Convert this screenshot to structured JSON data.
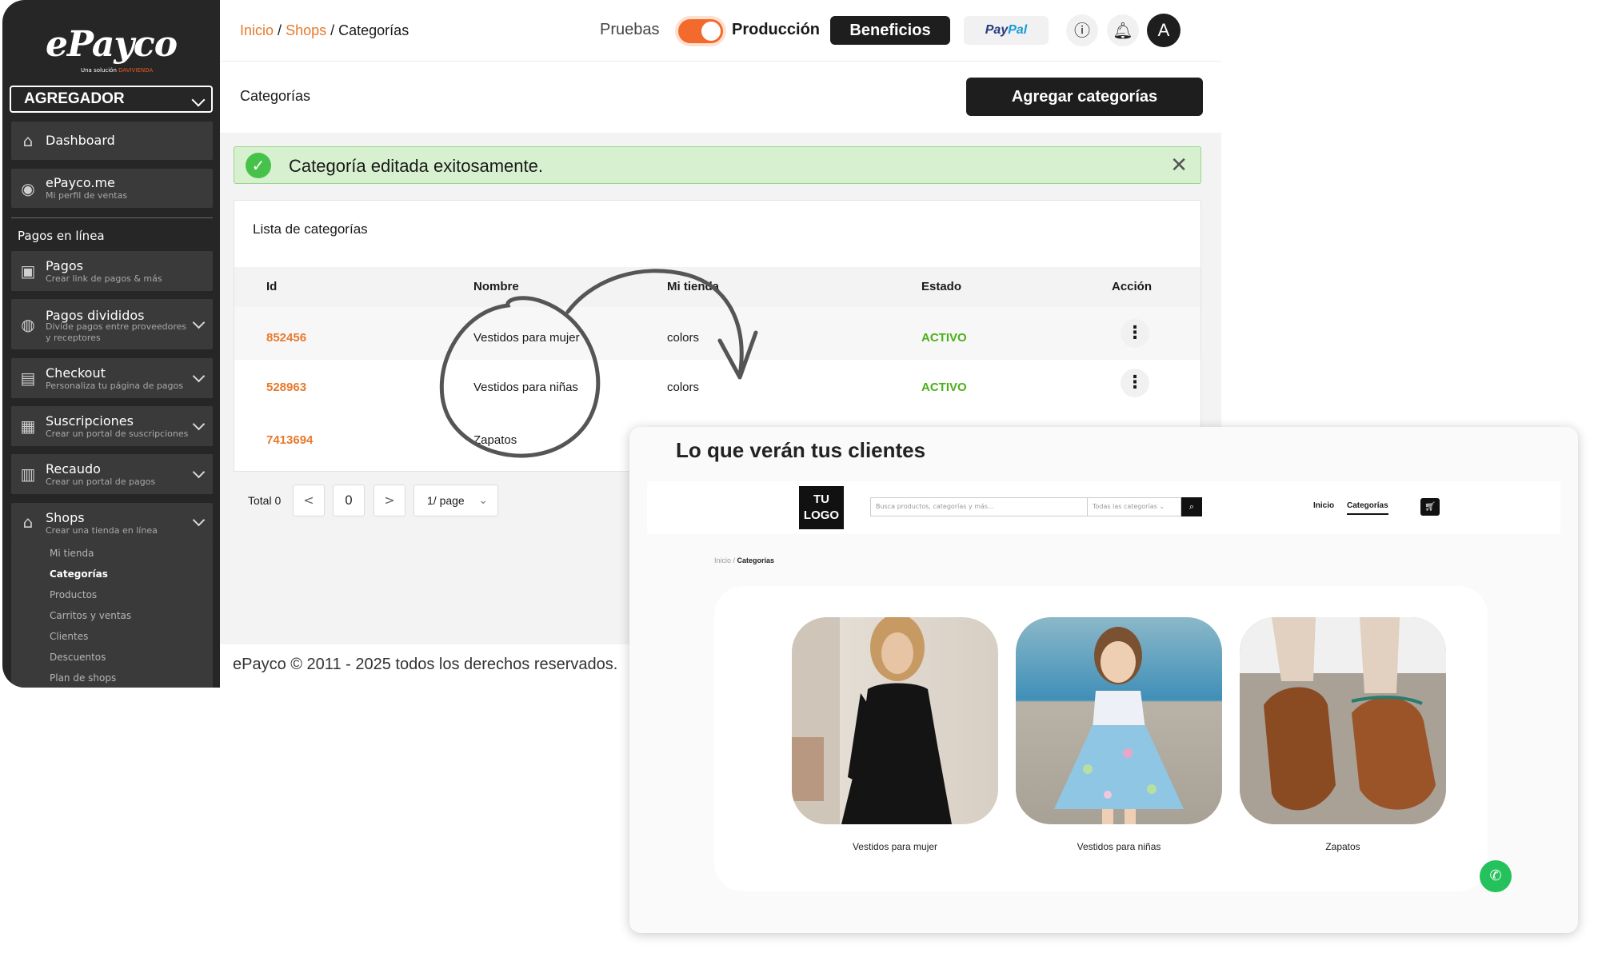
{
  "sidebar": {
    "logo": "ePayco",
    "logo_sub_prefix": "Una solución",
    "logo_sub_brand": "DAVIVIENDA",
    "account_type": "AGREGADOR",
    "items": [
      {
        "label": "Dashboard",
        "sub": ""
      },
      {
        "label": "ePayco.me",
        "sub": "Mi perfil de ventas"
      }
    ],
    "section_label": "Pagos en línea",
    "menu": [
      {
        "label": "Pagos",
        "sub": "Crear link de pagos & más"
      },
      {
        "label": "Pagos divididos",
        "sub": "Divide pagos entre proveedores y receptores"
      },
      {
        "label": "Checkout",
        "sub": "Personaliza tu página de pagos"
      },
      {
        "label": "Suscripciones",
        "sub": "Crear un portal de suscripciones"
      },
      {
        "label": "Recaudo",
        "sub": "Crear un portal de pagos"
      },
      {
        "label": "Shops",
        "sub": "Crear una tienda en línea"
      }
    ],
    "shops_submenu": [
      "Mi tienda",
      "Categorías",
      "Productos",
      "Carritos y ventas",
      "Clientes",
      "Descuentos",
      "Plan de shops"
    ],
    "shops_submenu_active": "Categorías"
  },
  "header": {
    "breadcrumb": [
      "Inicio",
      "Shops",
      "Categorías"
    ],
    "env_test": "Pruebas",
    "env_prod": "Producción",
    "benefits_label": "Beneficios",
    "paypal_pay": "Pay",
    "paypal_pal": "Pal",
    "avatar_letter": "A"
  },
  "page": {
    "title": "Categorías",
    "add_button": "Agregar categorías",
    "alert": "Categoría editada exitosamente.",
    "list_title": "Lista de categorías",
    "columns": [
      "Id",
      "Nombre",
      "Mi tienda",
      "Estado",
      "Acción"
    ],
    "rows": [
      {
        "id": "852456",
        "name": "Vestidos para mujer",
        "store": "colors",
        "state": "ACTIVO"
      },
      {
        "id": "528963",
        "name": "Vestidos para niñas",
        "store": "colors",
        "state": "ACTIVO"
      },
      {
        "id": "7413694",
        "name": "Zapatos",
        "store": "",
        "state": ""
      }
    ],
    "pagination": {
      "total_label": "Total 0",
      "prev": "<",
      "page": "0",
      "next": ">",
      "page_size": "1/ page"
    },
    "footer": "ePayco © 2011 - 2025 todos los derechos reservados."
  },
  "preview": {
    "title": "Lo que verán tus clientes",
    "store_logo_line1": "TU",
    "store_logo_line2": "LOGO",
    "search_placeholder": "Busca productos, categorías y más...",
    "category_select": "Todas las categorías",
    "nav": [
      "Inicio",
      "Categorías"
    ],
    "breadcrumb_home": "Inicio",
    "breadcrumb_current": "Categorías",
    "categories": [
      "Vestidos para mujer",
      "Vestidos para niñas",
      "Zapatos"
    ]
  },
  "colors": {
    "accent": "#e8792b",
    "sidebar": "#262626",
    "success": "#46c24a",
    "active_state": "#4caf1a"
  }
}
